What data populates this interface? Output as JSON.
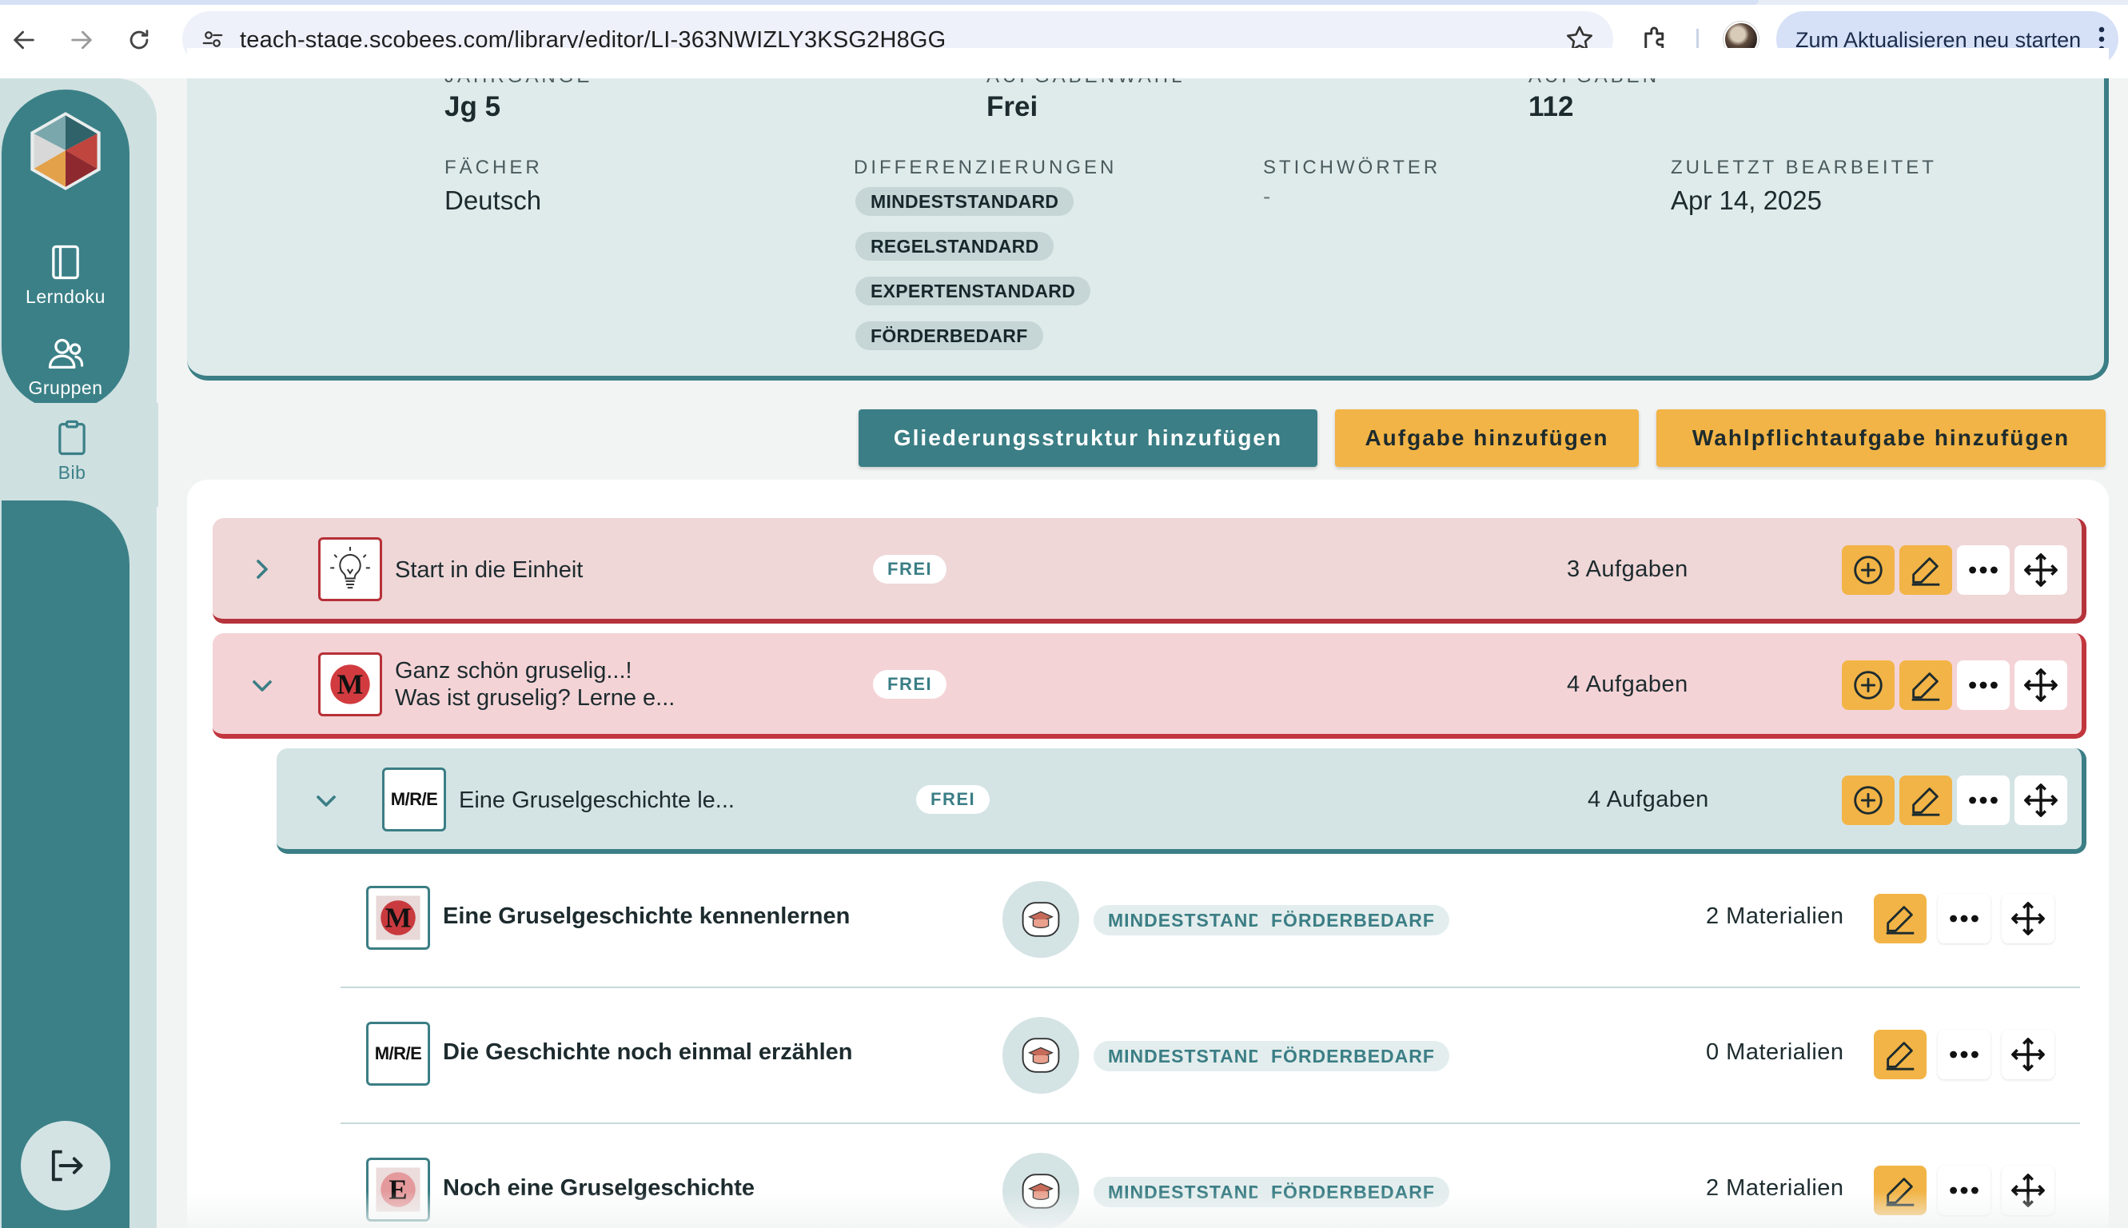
{
  "browser": {
    "url": "teach-stage.scobees.com/library/editor/LI-363NWIZLY3KSG2H8GG",
    "update_label": "Zum Aktualisieren neu starten",
    "icons": [
      "back-icon",
      "forward-icon",
      "reload-icon",
      "site-settings-icon",
      "bookmark-star-icon",
      "extensions-icon",
      "profile-avatar",
      "more-vert-icon"
    ]
  },
  "sidebar": {
    "items": [
      {
        "label": "Lerndoku",
        "icon": "notebook-icon"
      },
      {
        "label": "Gruppen",
        "icon": "users-icon"
      },
      {
        "label": "Bib",
        "icon": "clipboard-icon",
        "active": true
      }
    ],
    "logout_icon": "logout-icon"
  },
  "info": {
    "jahrgaenge": {
      "label": "JAHRGÄNGE",
      "value": "Jg 5"
    },
    "aufgabenwahl": {
      "label": "AUFGABENWAHL",
      "value": "Frei"
    },
    "aufgaben": {
      "label": "AUFGABEN",
      "value": "112"
    },
    "faecher": {
      "label": "FÄCHER",
      "value": "Deutsch"
    },
    "differenzierungen": {
      "label": "DIFFERENZIERUNGEN",
      "chips": [
        "MINDESTSTANDARD",
        "REGELSTANDARD",
        "EXPERTENSTANDARD",
        "FÖRDERBEDARF"
      ]
    },
    "stichwoerter": {
      "label": "STICHWÖRTER",
      "value": "-"
    },
    "zuletzt": {
      "label": "ZULETZT BEARBEITET",
      "value": "Apr 14, 2025"
    }
  },
  "actions": {
    "gliederung": "Gliederungsstruktur hinzufügen",
    "aufgabe": "Aufgabe hinzufügen",
    "wahlpflicht": "Wahlpflichtaufgabe hinzufügen"
  },
  "sections": [
    {
      "title": "Start in die Einheit",
      "chip": "FREI",
      "count": "3 Aufgaben",
      "icon": "lightbulb-icon",
      "expanded": false
    },
    {
      "title_line1": "Ganz schön gruselig...!",
      "title_line2": "Was ist gruselig? Lerne e...",
      "chip": "FREI",
      "count": "4 Aufgaben",
      "icon": "m-badge-icon",
      "expanded": true
    },
    {
      "title": "Eine Gruselgeschichte le...",
      "chip": "FREI",
      "count": "4 Aufgaben",
      "icon_text": "M/R/E",
      "expanded": true
    }
  ],
  "tasks": [
    {
      "title": "Eine Gruselgeschichte kennenlernen",
      "icon": "m-badge-icon",
      "levels": [
        "MINDESTSTANDARD",
        "FÖRDERBEDARF"
      ],
      "count": "2 Materialien"
    },
    {
      "title": "Die Geschichte noch einmal erzählen",
      "icon_text": "M/R/E",
      "levels": [
        "MINDESTSTANDARD",
        "FÖRDERBEDARF"
      ],
      "count": "0 Materialien"
    },
    {
      "title": "Noch eine Gruselgeschichte",
      "icon_letter": "E",
      "levels": [
        "MINDESTSTANDARD",
        "FÖRDERBEDARF"
      ],
      "count": "2 Materialien"
    }
  ],
  "colors": {
    "teal": "#3b7e85",
    "yellow": "#f2b446",
    "pink": "#efd6d7",
    "red_border": "#b5333a",
    "panel": "#dfebeb"
  }
}
